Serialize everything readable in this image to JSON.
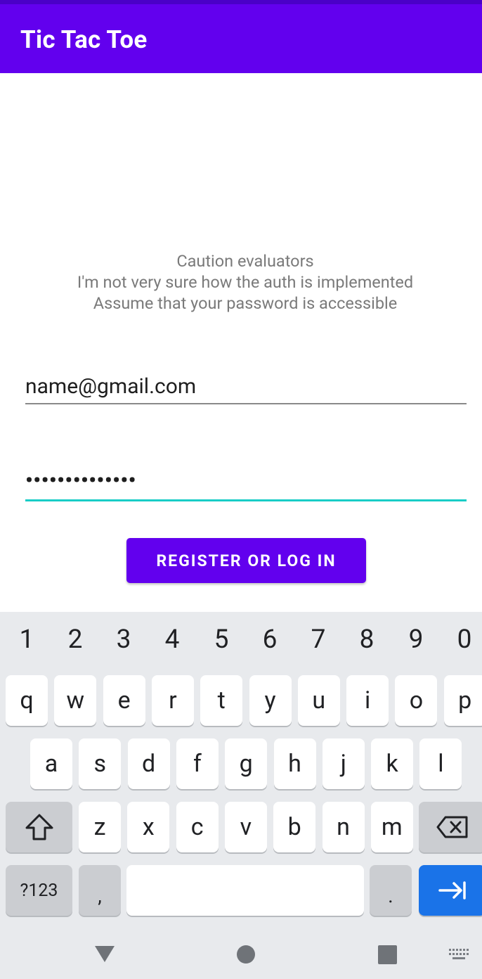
{
  "app": {
    "title": "Tic Tac Toe"
  },
  "notice": {
    "line1": "Caution evaluators",
    "line2": "I'm not very sure how the auth is implemented",
    "line3": "Assume that your password is accessible"
  },
  "form": {
    "email_value": "name@gmail.com",
    "password_value": "••••••••••••••",
    "submit_label": "REGISTER OR LOG IN"
  },
  "keyboard": {
    "numbers": [
      "1",
      "2",
      "3",
      "4",
      "5",
      "6",
      "7",
      "8",
      "9",
      "0"
    ],
    "row1": [
      "q",
      "w",
      "e",
      "r",
      "t",
      "y",
      "u",
      "i",
      "o",
      "p"
    ],
    "row2": [
      "a",
      "s",
      "d",
      "f",
      "g",
      "h",
      "j",
      "k",
      "l"
    ],
    "row3": [
      "z",
      "x",
      "c",
      "v",
      "b",
      "n",
      "m"
    ],
    "symbols_label": "?123",
    "comma_label": ",",
    "period_label": ".",
    "shift_icon": "shift-icon",
    "backspace_icon": "backspace-icon",
    "enter_icon": "tab-next-icon"
  },
  "colors": {
    "primary": "#6200ee",
    "accent": "#18cdc6",
    "keyboard_enter": "#1a73e8"
  },
  "nav": {
    "back_icon": "back-triangle-icon",
    "home_icon": "home-circle-icon",
    "recents_icon": "recents-square-icon",
    "keyboard_icon": "keyboard-icon"
  }
}
